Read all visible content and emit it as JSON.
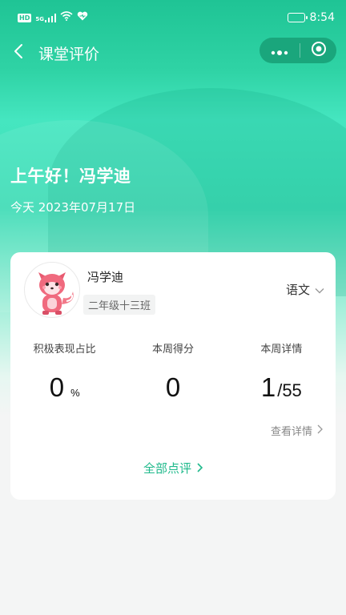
{
  "status_bar": {
    "hd": "HD",
    "signal": "5G",
    "time": "8:54"
  },
  "navbar": {
    "title": "课堂评价",
    "back_icon": "chevron-left-icon",
    "more_icon": "more-dots-icon",
    "close_icon": "target-close-icon"
  },
  "header": {
    "greeting": "上午好！冯学迪",
    "date": "今天 2023年07月17日"
  },
  "student": {
    "name": "冯学迪",
    "class_name": "二年级十三班",
    "subject": "语文"
  },
  "stats": [
    {
      "label": "积极表现占比",
      "value": "0",
      "unit": "%"
    },
    {
      "label": "本周得分",
      "value": "0"
    },
    {
      "label": "本周详情",
      "value": "1",
      "total": "/55"
    }
  ],
  "links": {
    "view_detail": "查看详情",
    "all_comments": "全部点评"
  },
  "colors": {
    "accent": "#1fb98b",
    "header_green": "#21c393",
    "capsule": "#1aa67c"
  }
}
